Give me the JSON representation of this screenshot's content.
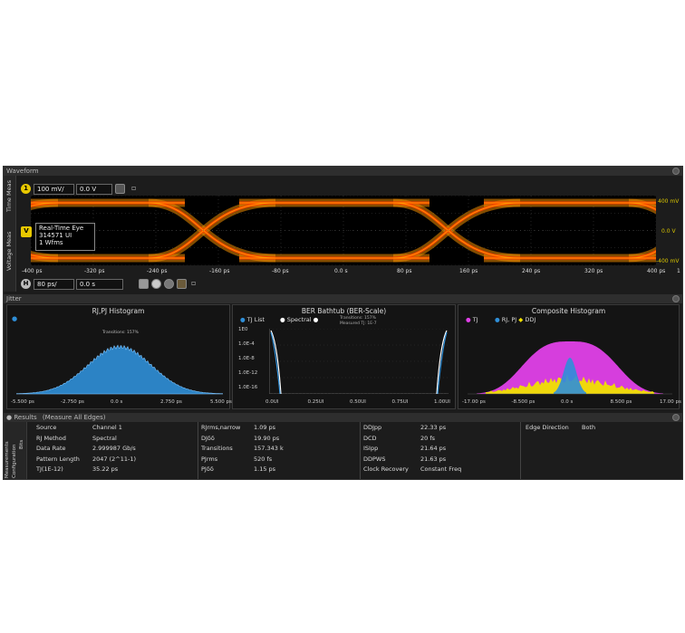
{
  "waveform": {
    "title": "Waveform",
    "side_tabs": [
      "Time Meas",
      "Voltage Meas"
    ],
    "channel": {
      "badge": "1",
      "scale": "100 mV/",
      "offset": "0.0 V"
    },
    "timebase": {
      "badge": "H",
      "scale": "80 ps/",
      "position": "0.0 s"
    },
    "marker_label": "V",
    "eye_info": [
      "Real-Time Eye",
      "314571 UI",
      "1 Wfms"
    ],
    "y_labels": [
      "400 mV",
      "0.0 V",
      "-400 mV"
    ],
    "x_labels": [
      "-400 ps",
      "-320 ps",
      "-240 ps",
      "-160 ps",
      "-80 ps",
      "0.0 s",
      "80 ps",
      "160 ps",
      "240 ps",
      "320 ps",
      "400 ps"
    ],
    "colors": {
      "eye": "#f08c00",
      "eye_core": "#ff3b00",
      "background": "#000000"
    }
  },
  "jitter": {
    "title": "Jitter",
    "rjpj": {
      "title": "RJ,PJ Histogram",
      "transitions": "Transitions: 157%",
      "x_labels": [
        "-5.500 ps",
        "-2.750 ps",
        "0.0 s",
        "2.750 ps",
        "5.500 ps"
      ],
      "color": "#2f8fd8"
    },
    "bathtub": {
      "title": "BER Bathtub (BER-Scale)",
      "legend": [
        "TJ List",
        "Spectral"
      ],
      "note": [
        "Transitions: 157%",
        "Measured TJ: 1E-7"
      ],
      "y_labels": [
        "1E0",
        "1.0E-4",
        "1.0E-8",
        "1.0E-12",
        "1.0E-16"
      ],
      "x_labels": [
        "0.0UI",
        "0.25UI",
        "0.50UI",
        "0.75UI",
        "1.00UI"
      ]
    },
    "composite": {
      "title": "Composite Histogram",
      "legend": [
        "TJ",
        "RJ, PJ",
        "DDJ"
      ],
      "x_labels": [
        "-17.00 ps",
        "-8.500 ps",
        "0.0 s",
        "8.500 ps",
        "17.00 ps"
      ],
      "colors": {
        "tj": "#e040e8",
        "rjpj": "#2f8fd8",
        "ddj": "#f0e000"
      }
    }
  },
  "results": {
    "title": "Results",
    "subtitle": "(Measure All Edges)",
    "side_tabs": [
      "Measurements",
      "Configuration",
      "Bits"
    ],
    "col1": [
      {
        "k": "Source",
        "v": "Channel 1"
      },
      {
        "k": "RJ Method",
        "v": "Spectral"
      },
      {
        "k": "Data Rate",
        "v": "2.999987 Gb/s"
      },
      {
        "k": "Pattern Length",
        "v": "2047 (2^11-1)"
      },
      {
        "k": "TJ(1E-12)",
        "v": "35.22 ps"
      }
    ],
    "col2": [
      {
        "k": "RJrms,narrow",
        "v": "1.09 ps"
      },
      {
        "k": "DJδδ",
        "v": "19.90 ps"
      },
      {
        "k": "Transitions",
        "v": "157.343 k"
      },
      {
        "k": "PJrms",
        "v": "520 fs"
      },
      {
        "k": "PJδδ",
        "v": "1.15 ps"
      }
    ],
    "col3": [
      {
        "k": "DDJpp",
        "v": "22.33 ps"
      },
      {
        "k": "DCD",
        "v": "20 fs"
      },
      {
        "k": "ISIpp",
        "v": "21.64 ps"
      },
      {
        "k": "DDPWS",
        "v": "21.63 ps"
      },
      {
        "k": "Clock Recovery",
        "v": "Constant Freq"
      }
    ],
    "col4": [
      {
        "k": "Edge Direction",
        "v": "Both"
      }
    ]
  }
}
